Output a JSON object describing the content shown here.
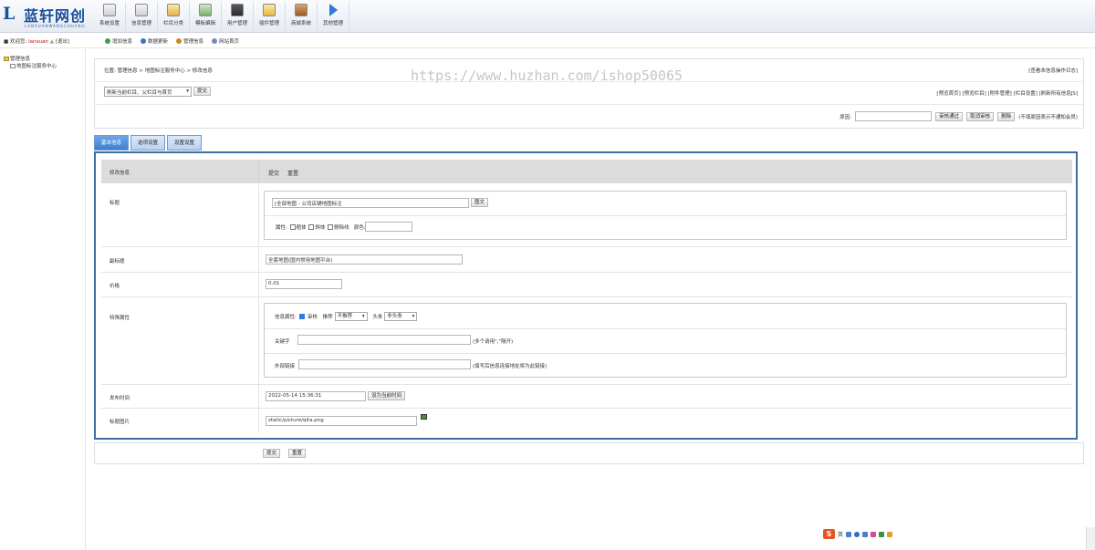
{
  "logo": {
    "mark": "L",
    "name": "蓝轩网创",
    "sub": "LANXUANWANGCHUANG"
  },
  "nav": [
    {
      "label": "系统设置",
      "icon": "settings-icon"
    },
    {
      "label": "信息管理",
      "icon": "info-manage-icon"
    },
    {
      "label": "栏目分类",
      "icon": "category-icon"
    },
    {
      "label": "模板编辑",
      "icon": "template-icon"
    },
    {
      "label": "用户管理",
      "icon": "users-icon"
    },
    {
      "label": "插件管理",
      "icon": "plugin-icon"
    },
    {
      "label": "商城系统",
      "icon": "shop-icon"
    },
    {
      "label": "其他管理",
      "icon": "other-icon"
    }
  ],
  "user": {
    "welcome": "欢迎您:",
    "name": "lanxuan",
    "logout": "[退出]"
  },
  "quick_links": [
    {
      "label": "增加信息",
      "color": "#3aa14a"
    },
    {
      "label": "数据更新",
      "color": "#2f79c9"
    },
    {
      "label": "管理信息",
      "color": "#d08a1a"
    },
    {
      "label": "网站首页",
      "color": "#6a8fb8"
    }
  ],
  "sidebar": {
    "root": "管理信息",
    "child": "地图标注服务中心"
  },
  "breadcrumb": {
    "text": "位置:  管理信息 > 地图标注服务中心 > 修改信息",
    "right": "[查看本信息操作日志]"
  },
  "toolbar": {
    "select_value": "刷新当前栏目、父栏目与首页",
    "submit": "提交",
    "right_links": "[预览首页] [预览栏目] [附件管理] [栏目设置] [刷新所有信息JS]"
  },
  "audit": {
    "reason_label": "原因:",
    "approve": "审核通过",
    "cancel": "取消审核",
    "delete": "删除",
    "note": "(不填原因表示不通知会员)"
  },
  "watermark": "https://www.huzhan.com/ishop50065",
  "tabs": [
    {
      "label": "基本信息",
      "active": true
    },
    {
      "label": "选项设置",
      "active": false
    },
    {
      "label": "设置设置",
      "active": false
    }
  ],
  "form": {
    "head_label": "修改信息",
    "head_submit": "提交",
    "head_reset": "重置",
    "title_label": "标题",
    "title_value": "[全部地图 - 公司店铺地图标注",
    "title_btn": "图文",
    "attr_label": "属性:",
    "attr_bold": "粗体",
    "attr_italic": "斜体",
    "attr_strike": "删除线",
    "color_label": "颜色:",
    "subtitle_label": "副标题",
    "subtitle_value": "全套地图(国内常用地图平台)",
    "price_label": "价格",
    "price_value": "0.01",
    "special_label": "特殊属性",
    "info_attr_label": "信息属性:",
    "audit_check": "审核",
    "recommend_label": "推荐",
    "recommend_value": "不推荐",
    "headline_label": "头条",
    "headline_value": "非头条",
    "keywords_label": "关键字",
    "keywords_hint": "(多个请用\",\"隔开)",
    "external_label": "外部链接",
    "external_hint": "(填写后信息连接地址将为此链接)",
    "time_label": "发布时间",
    "time_value": "2022-05-14 15:36:31",
    "time_btn": "设为当前时间",
    "image_label": "标题图片",
    "image_value": "static/picture/qita.png"
  },
  "bottom": {
    "submit": "提交",
    "reset": "重置"
  },
  "tray": {
    "ime": "S",
    "lang": "英"
  }
}
